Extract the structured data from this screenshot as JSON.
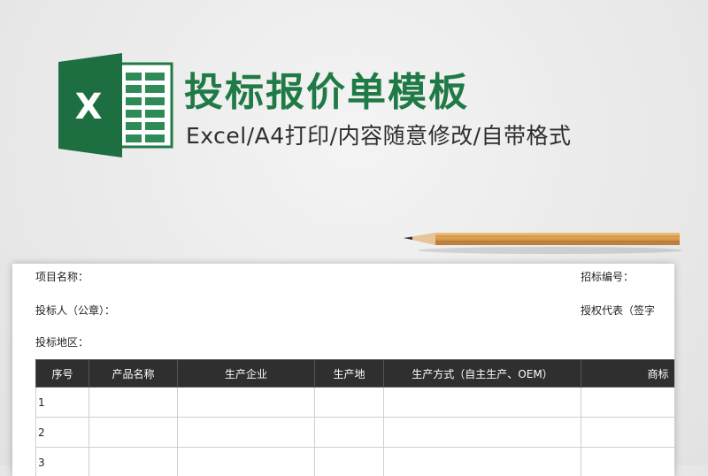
{
  "header": {
    "title": "投标报价单模板",
    "subtitle": "Excel/A4打印/内容随意修改/自带格式",
    "logo_letter": "X",
    "accent_color": "#1f7a45",
    "logo_icon": "excel-logo-icon"
  },
  "decoration": {
    "pencil_icon": "pencil-icon"
  },
  "sheet": {
    "project_name_label": "项目名称：",
    "bidder_label": "投标人（公章）：",
    "region_label": "投标地区：",
    "tender_no_label": "招标编号：",
    "authorized_rep_label": "授权代表（签字",
    "columns": [
      "序号",
      "产品名称",
      "生产企业",
      "生产地",
      "生产方式（自主生产、OEM）",
      "商标"
    ],
    "rows": [
      [
        "1",
        "",
        "",
        "",
        "",
        ""
      ],
      [
        "2",
        "",
        "",
        "",
        "",
        ""
      ],
      [
        "3",
        "",
        "",
        "",
        "",
        ""
      ]
    ]
  }
}
